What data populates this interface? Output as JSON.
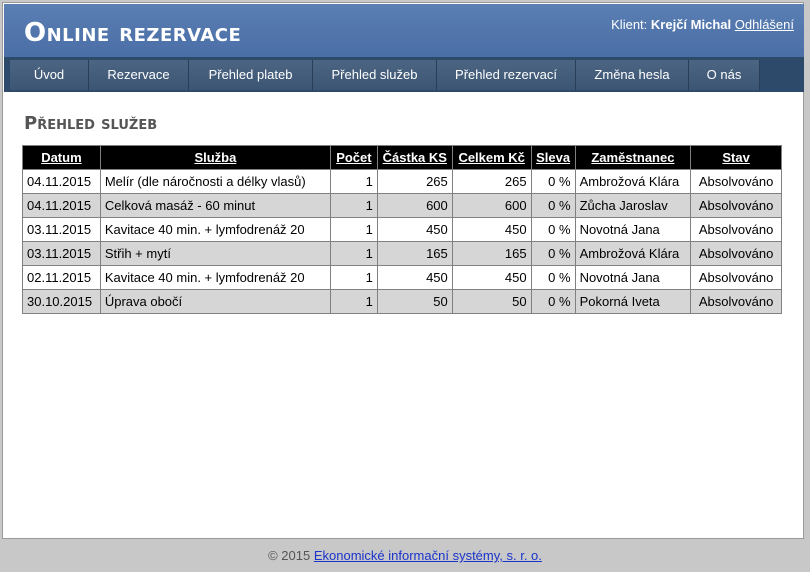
{
  "header": {
    "app_title": "Online rezervace",
    "client_label": "Klient:",
    "client_name": "Krejčí Michal",
    "logout_label": "Odhlášení"
  },
  "nav": {
    "items": [
      {
        "label": "Úvod"
      },
      {
        "label": "Rezervace"
      },
      {
        "label": "Přehled plateb"
      },
      {
        "label": "Přehled služeb"
      },
      {
        "label": "Přehled rezervací"
      },
      {
        "label": "Změna hesla"
      },
      {
        "label": "O nás"
      }
    ]
  },
  "page": {
    "title": "Přehled služeb"
  },
  "table": {
    "columns": [
      "Datum",
      "Služba",
      "Počet",
      "Částka KS",
      "Celkem Kč",
      "Sleva",
      "Zaměstnanec",
      "Stav"
    ],
    "rows": [
      {
        "datum": "04.11.2015",
        "sluzba": "Melír (dle náročnosti a délky vlasů)",
        "pocet": "1",
        "castka": "265",
        "celkem": "265",
        "sleva": "0 %",
        "zamestnanec": "Ambrožová Klára",
        "stav": "Absolvováno"
      },
      {
        "datum": "04.11.2015",
        "sluzba": "Celková masáž - 60 minut",
        "pocet": "1",
        "castka": "600",
        "celkem": "600",
        "sleva": "0 %",
        "zamestnanec": "Zůcha Jaroslav",
        "stav": "Absolvováno"
      },
      {
        "datum": "03.11.2015",
        "sluzba": "Kavitace 40 min. + lymfodrenáž 20",
        "pocet": "1",
        "castka": "450",
        "celkem": "450",
        "sleva": "0 %",
        "zamestnanec": "Novotná Jana",
        "stav": "Absolvováno"
      },
      {
        "datum": "03.11.2015",
        "sluzba": "Střih + mytí",
        "pocet": "1",
        "castka": "165",
        "celkem": "165",
        "sleva": "0 %",
        "zamestnanec": "Ambrožová Klára",
        "stav": "Absolvováno"
      },
      {
        "datum": "02.11.2015",
        "sluzba": "Kavitace 40 min. + lymfodrenáž 20",
        "pocet": "1",
        "castka": "450",
        "celkem": "450",
        "sleva": "0 %",
        "zamestnanec": "Novotná Jana",
        "stav": "Absolvováno"
      },
      {
        "datum": "30.10.2015",
        "sluzba": "Úprava obočí",
        "pocet": "1",
        "castka": "50",
        "celkem": "50",
        "sleva": "0 %",
        "zamestnanec": "Pokorná Iveta",
        "stav": "Absolvováno"
      }
    ]
  },
  "footer": {
    "copyright": "© 2015",
    "company_link": "Ekonomické informační systémy, s. r. o."
  },
  "colors": {
    "header_blue": "#4a6ea6",
    "nav_dark": "#2e4a6b",
    "table_header": "#000000",
    "alt_row": "#d6d6d6",
    "link": "#1a33cc"
  }
}
